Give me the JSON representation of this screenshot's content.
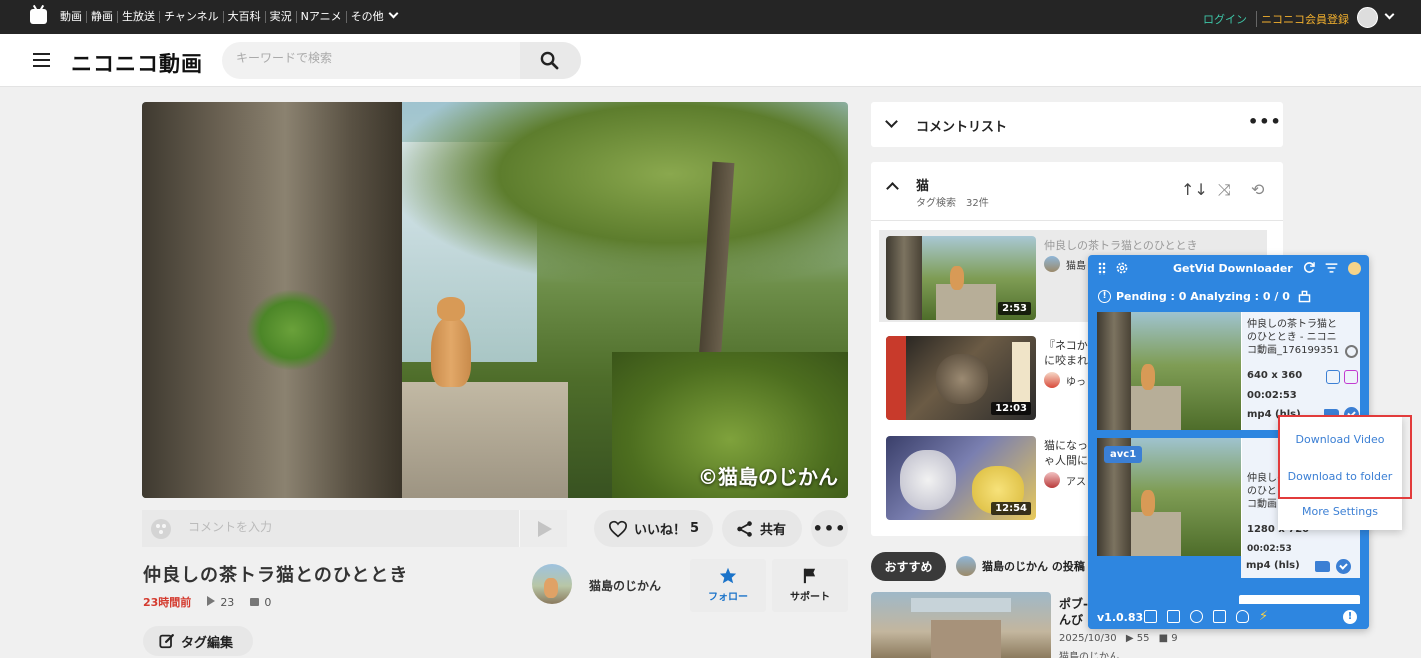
{
  "topbar": {
    "nav": [
      "動画",
      "静画",
      "生放送",
      "チャンネル",
      "大百科",
      "実況",
      "Nアニメ",
      "その他"
    ],
    "login": "ログイン",
    "register": "ニコニコ会員登録"
  },
  "header": {
    "brand": "ニコニコ動画",
    "search_placeholder": "キーワードで検索"
  },
  "video": {
    "watermark": "©猫島のじかん",
    "comment_placeholder": "コメントを入力",
    "like_label": "いいね！",
    "like_count": "5",
    "share_label": "共有",
    "title": "仲良しの茶トラ猫とのひととき",
    "posted": "23時間前",
    "views": "23",
    "comments": "0",
    "tag_edit": "タグ編集",
    "channel_name": "猫島のじかん",
    "follow_label": "フォロー",
    "support_label": "サポート"
  },
  "commentlist": {
    "title": "コメントリスト"
  },
  "playlist": {
    "title": "猫",
    "subtitle": "タグ検索　32件",
    "items": [
      {
        "title": "仲良しの茶トラ猫とのひととき",
        "owner": "猫島",
        "duration": "2:53"
      },
      {
        "title": "『ネコか\nに咬まれ",
        "owner": "ゆっ",
        "duration": "12:03"
      },
      {
        "title": "猫になっ\nゃ人間に",
        "owner": "アス",
        "duration": "12:54"
      }
    ]
  },
  "recommend": {
    "tab": "おすすめ",
    "channel": "猫島のじかん の投稿",
    "title": "ポブ-\nんび",
    "date": "2025/10/30",
    "views": "55",
    "comments": "9",
    "owner": "猫島のじかん"
  },
  "getvid": {
    "title": "GetVid Downloader",
    "status": "Pending : 0  Analyzing : 0 / 0",
    "version": "v1.0.83",
    "items": [
      {
        "filename": "仲良しの茶トラ猫とのひととき - ニコニコ動画_1761993518",
        "resolution": "640 x 360",
        "duration": "00:02:53",
        "format": "mp4 (hls)",
        "badge": ""
      },
      {
        "filename": "仲良しの茶トラ猫とのひととき - ニコニコ動画",
        "resolution": "1280 x 720",
        "duration": "00:02:53",
        "format": "mp4 (hls)",
        "badge": "avc1"
      }
    ]
  },
  "dropdown": {
    "download_video": "Download Video",
    "download_folder": "Download to folder",
    "more_settings": "More Settings"
  },
  "colors": {
    "topbar": "#252525",
    "login": "#3ec6a8",
    "register": "#f2b02e",
    "getvid_blue": "#2e86e0",
    "highlight_red": "#e23b3b",
    "posted_red": "#d43b2f"
  }
}
